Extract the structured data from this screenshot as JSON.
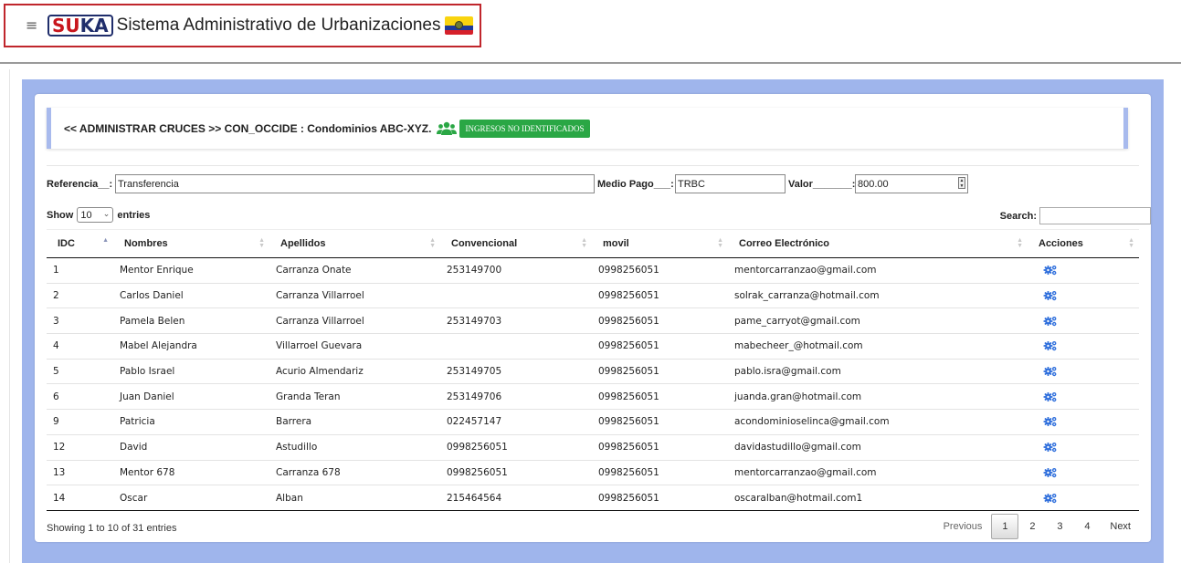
{
  "header": {
    "menu_icon": "hamburger-icon",
    "logo_text_1": "SU",
    "logo_text_2": "KA",
    "title": "Sistema Administrativo de Urbanizaciones",
    "flag_icon": "ecuador-flag-icon",
    "accent_color": "#c0262c"
  },
  "callout": {
    "text": "<< ADMINISTRAR CRUCES >> CON_OCCIDE : Condominios ABC-XYZ.",
    "users_icon": "users-icon",
    "button_label": "INGRESOS NO IDENTIFICADOS",
    "button_color": "#2aa745"
  },
  "form": {
    "referencia_label": "Referencia__:",
    "referencia_value": "Transferencia",
    "medio_label": "Medio Pago___:",
    "medio_value": "TRBC",
    "valor_label": "Valor_______:",
    "valor_value": "800.00"
  },
  "table_controls": {
    "show_label": "Show",
    "length_value": "10",
    "entries_label": "entries",
    "search_label": "Search:"
  },
  "table": {
    "columns": [
      "IDC",
      "Nombres",
      "Apellidos",
      "Convencional",
      "movil",
      "Correo Electrónico",
      "Acciones"
    ],
    "rows": [
      [
        "1",
        "Mentor Enrique",
        "Carranza Onate",
        "253149700",
        "0998256051",
        "mentorcarranzao@gmail.com"
      ],
      [
        "2",
        "Carlos Daniel",
        "Carranza Villarroel",
        "",
        "0998256051",
        "solrak_carranza@hotmail.com"
      ],
      [
        "3",
        "Pamela Belen",
        "Carranza Villarroel",
        "253149703",
        "0998256051",
        "pame_carryot@gmail.com"
      ],
      [
        "4",
        "Mabel Alejandra",
        "Villarroel Guevara",
        "",
        "0998256051",
        "mabecheer_@hotmail.com"
      ],
      [
        "5",
        "Pablo Israel",
        "Acurio Almendariz",
        "253149705",
        "0998256051",
        "pablo.isra@gmail.com"
      ],
      [
        "6",
        "Juan Daniel",
        "Granda Teran",
        "253149706",
        "0998256051",
        "juanda.gran@hotmail.com"
      ],
      [
        "9",
        "Patricia",
        "Barrera",
        "022457147",
        "0998256051",
        "acondominioselinca@gmail.com"
      ],
      [
        "12",
        "David",
        "Astudillo",
        "0998256051",
        "0998256051",
        "davidastudillo@gmail.com"
      ],
      [
        "13",
        "Mentor 678",
        "Carranza 678",
        "0998256051",
        "0998256051",
        "mentorcarranzao@gmail.com"
      ],
      [
        "14",
        "Oscar",
        "Alban",
        "215464564",
        "0998256051",
        "oscaralban@hotmail.com1"
      ]
    ],
    "action_icon": "gears-icon",
    "action_color": "#2f6fdc"
  },
  "footer": {
    "info": "Showing 1 to 10 of 31 entries",
    "previous": "Previous",
    "pages": [
      "1",
      "2",
      "3",
      "4"
    ],
    "current_page": "1",
    "next": "Next"
  }
}
